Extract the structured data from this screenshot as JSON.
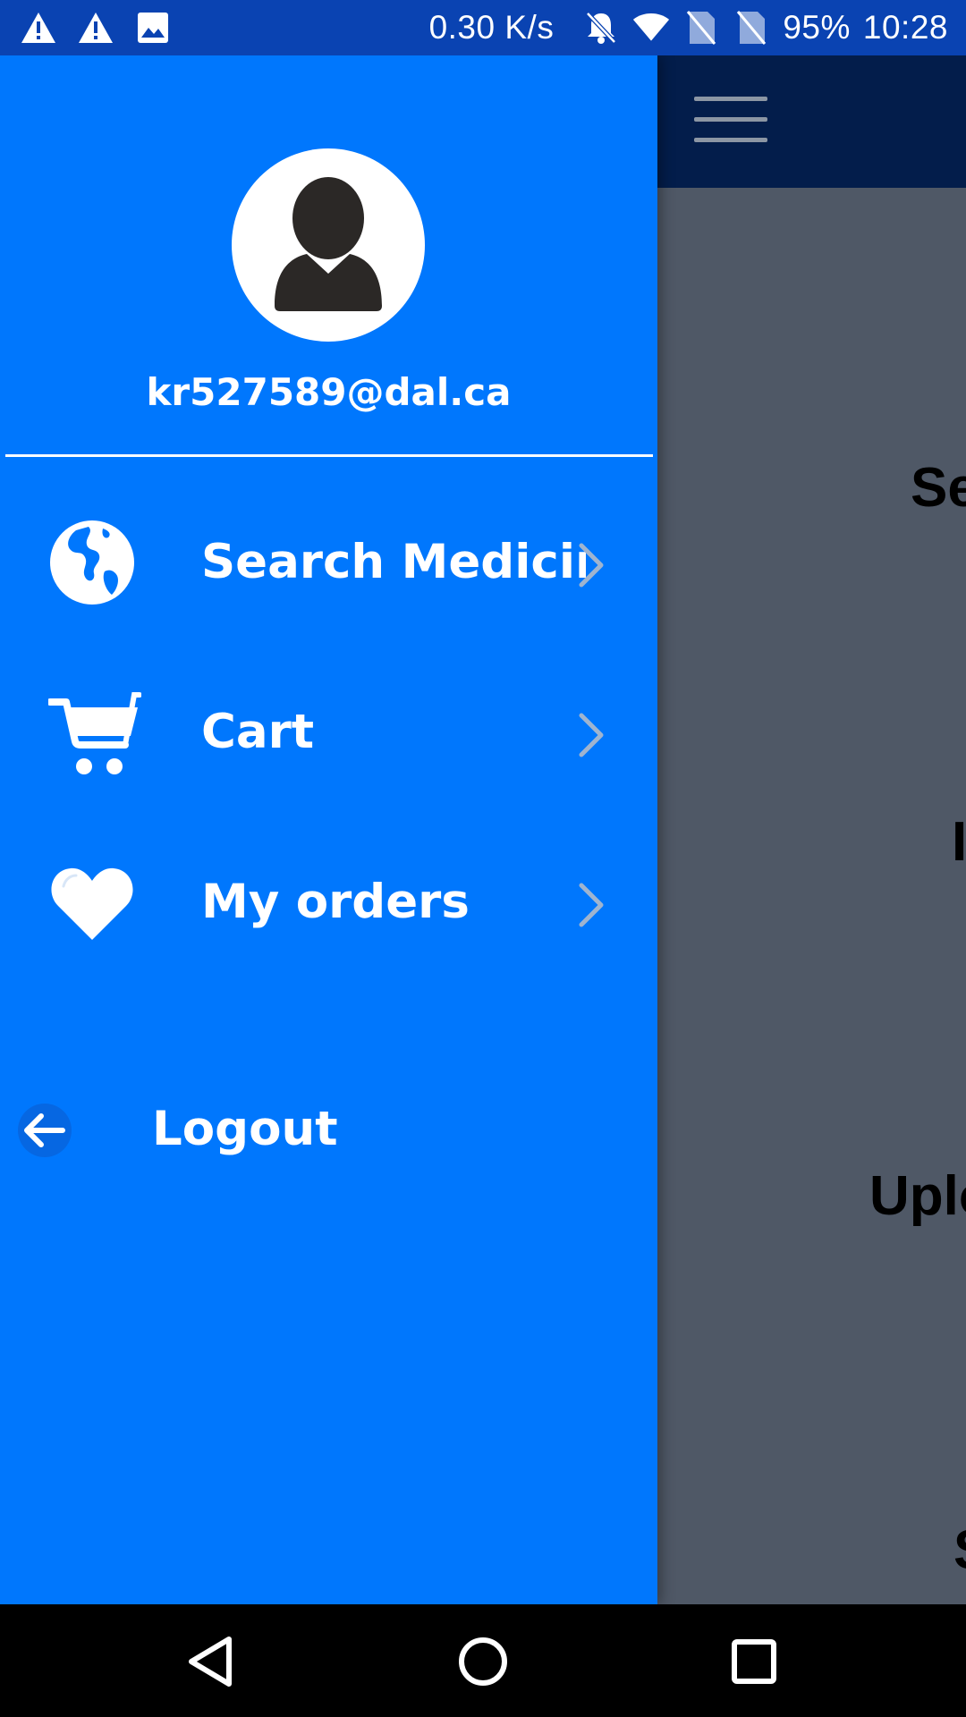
{
  "status_bar": {
    "net_speed": "0.30 K/s",
    "battery": "95%",
    "time": "10:28",
    "icons": [
      "warning-icon",
      "warning-icon",
      "image-icon",
      "bell-off-icon",
      "wifi-icon",
      "no-sim-icon",
      "no-sim-icon"
    ]
  },
  "drawer": {
    "email": "kr527589@dal.ca",
    "items": [
      {
        "label": "Search Medicine",
        "icon": "globe-icon"
      },
      {
        "label": "Cart",
        "icon": "cart-icon"
      },
      {
        "label": "My orders",
        "icon": "heart-icon"
      }
    ],
    "logout_label": "Logout"
  },
  "background_page": {
    "fragments": [
      "Se",
      "I",
      "Uplo",
      "S"
    ]
  },
  "colors": {
    "drawer_bg": "#0077fd",
    "status_bar_bg": "#0a43b2",
    "app_toolbar_bg": "#031d4b",
    "scrim": "#4f5866"
  }
}
